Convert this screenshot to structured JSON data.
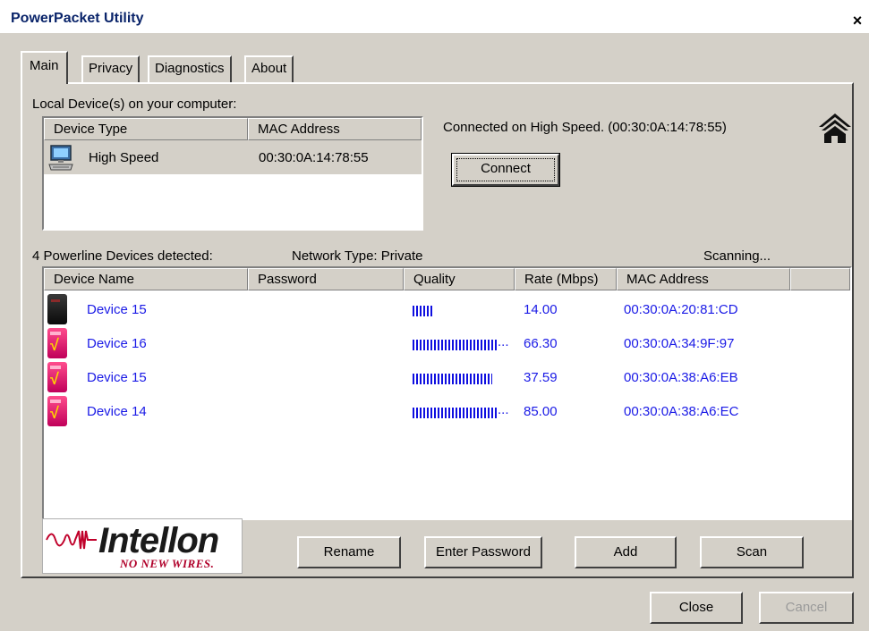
{
  "window": {
    "title": "PowerPacket Utility",
    "close_glyph": "×"
  },
  "tabs": [
    {
      "label": "Main",
      "active": true
    },
    {
      "label": "Privacy",
      "active": false
    },
    {
      "label": "Diagnostics",
      "active": false
    },
    {
      "label": "About",
      "active": false
    }
  ],
  "local": {
    "heading": "Local Device(s) on your computer:",
    "columns": [
      "Device Type",
      "MAC Address"
    ],
    "rows": [
      {
        "type": "High Speed",
        "mac": "00:30:0A:14:78:55",
        "icon": "computer-icon"
      }
    ]
  },
  "connection": {
    "status": "Connected on  High Speed. (00:30:0A:14:78:55)",
    "connect_label": "Connect",
    "status_icon": "house-icon"
  },
  "powerline": {
    "detected_text": "4 Powerline Devices detected:",
    "network_type_text": "Network Type: Private",
    "scanning_text": "Scanning...",
    "columns": [
      "Device Name",
      "Password",
      "Quality",
      "Rate (Mbps)",
      "MAC Address"
    ],
    "rows": [
      {
        "name": "Device 15",
        "password": "",
        "quality": "IIIIIII",
        "quality_fraction": 0.25,
        "rate": "14.00",
        "mac": "00:30:0A:20:81:CD",
        "icon": "black"
      },
      {
        "name": "Device 16",
        "password": "",
        "quality": "IIIIIIIIIIIIIIIII...",
        "quality_fraction": 1.0,
        "rate": "66.30",
        "mac": "00:30:0A:34:9F:97",
        "icon": "pink"
      },
      {
        "name": "Device 15",
        "password": "",
        "quality": "IIIIIIIIIIIIIIIII",
        "quality_fraction": 0.95,
        "rate": "37.59",
        "mac": "00:30:0A:38:A6:EB",
        "icon": "pink"
      },
      {
        "name": "Device 14",
        "password": "",
        "quality": "IIIIIIIIIIIIIIIII...",
        "quality_fraction": 1.0,
        "rate": "85.00",
        "mac": "00:30:0A:38:A6:EC",
        "icon": "pink"
      }
    ]
  },
  "logo": {
    "name": "Intellon",
    "tagline": "NO NEW WIRES."
  },
  "actions": {
    "rename": "Rename",
    "enter_password": "Enter Password",
    "add": "Add",
    "scan": "Scan"
  },
  "footer": {
    "close": "Close",
    "cancel": "Cancel"
  },
  "colors": {
    "title_text": "#0a246a",
    "link_blue": "#1a1ae6",
    "dialog_bg": "#d4d0c8"
  }
}
